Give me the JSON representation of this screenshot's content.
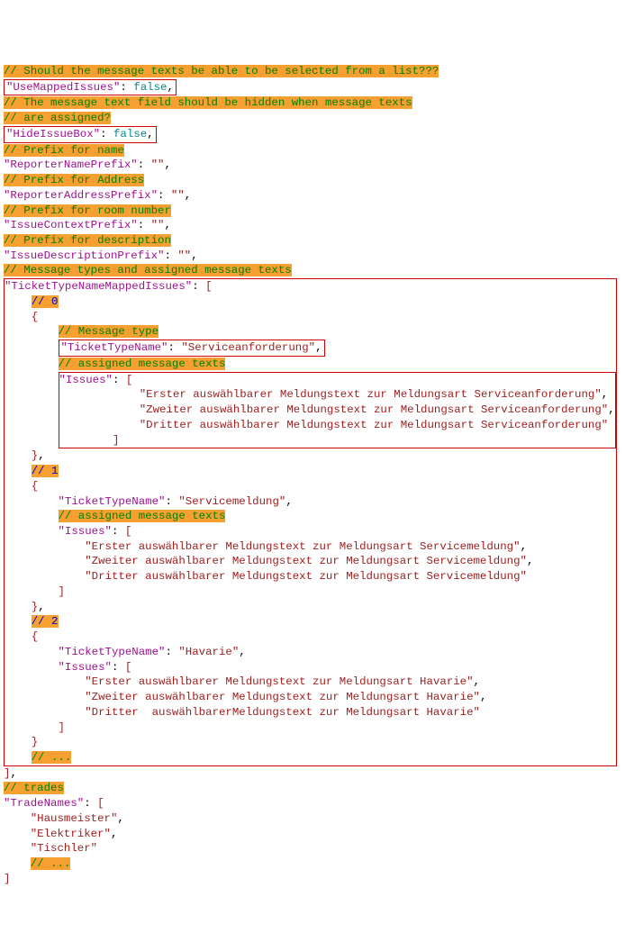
{
  "c": {
    "selectList": "// Should the message texts be able to be selected from a list???",
    "hideField": "// The message text field should be hidden when message texts",
    "assigned": "// are assigned?",
    "pfxName": "// Prefix for name",
    "pfxAddr": "// Prefix for Address",
    "pfxRoom": "// Prefix for room number",
    "pfxDesc": "// Prefix for description",
    "mapped": "// Message types and assigned message texts",
    "i0": "// 0",
    "i1": "// 1",
    "i2": "// 2",
    "msgType": "// Message type",
    "assignedTexts": "// assigned message texts",
    "etc": "// ...",
    "trades": "// trades"
  },
  "k": {
    "useMapped": "\"UseMappedIssues\"",
    "hideBox": "\"HideIssueBox\"",
    "repName": "\"ReporterNamePrefix\"",
    "repAddr": "\"ReporterAddressPrefix\"",
    "ctx": "\"IssueContextPrefix\"",
    "desc": "\"IssueDescriptionPrefix\"",
    "ttMapped": "\"TicketTypeNameMappedIssues\"",
    "ttName": "\"TicketTypeName\"",
    "issues": "\"Issues\"",
    "trades": "\"TradeNames\""
  },
  "v": {
    "false": "false",
    "empty": "\"\"",
    "serviceanf": "\"Serviceanforderung\"",
    "servicemeld": "\"Servicemeldung\"",
    "havarie": "\"Havarie\"",
    "colon": ": ",
    "comma": ",",
    "lbrk": "[",
    "rbrk": "]",
    "lcur": "{",
    "rcur": "}"
  },
  "issues": {
    "a": [
      "\"Erster auswählbarer Meldungstext zur Meldungsart Serviceanforderung\"",
      "\"Zweiter auswählbarer Meldungstext zur Meldungsart Serviceanforderung\"",
      "\"Dritter auswählbarer Meldungstext zur Meldungsart Serviceanforderung\""
    ],
    "b": [
      "\"Erster auswählbarer Meldungstext zur Meldungsart Servicemeldung\"",
      "\"Zweiter auswählbarer Meldungstext zur Meldungsart Servicemeldung\"",
      "\"Dritter auswählbarer Meldungstext zur Meldungsart Servicemeldung\""
    ],
    "c": [
      "\"Erster auswählbarer Meldungstext zur Meldungsart Havarie\"",
      "\"Zweiter auswählbarer Meldungstext zur Meldungsart Havarie\"",
      "\"Dritter  auswählbarerMeldungstext zur Meldungsart Havarie\""
    ]
  },
  "trades": [
    "\"Hausmeister\"",
    "\"Elektriker\"",
    "\"Tischler\""
  ]
}
